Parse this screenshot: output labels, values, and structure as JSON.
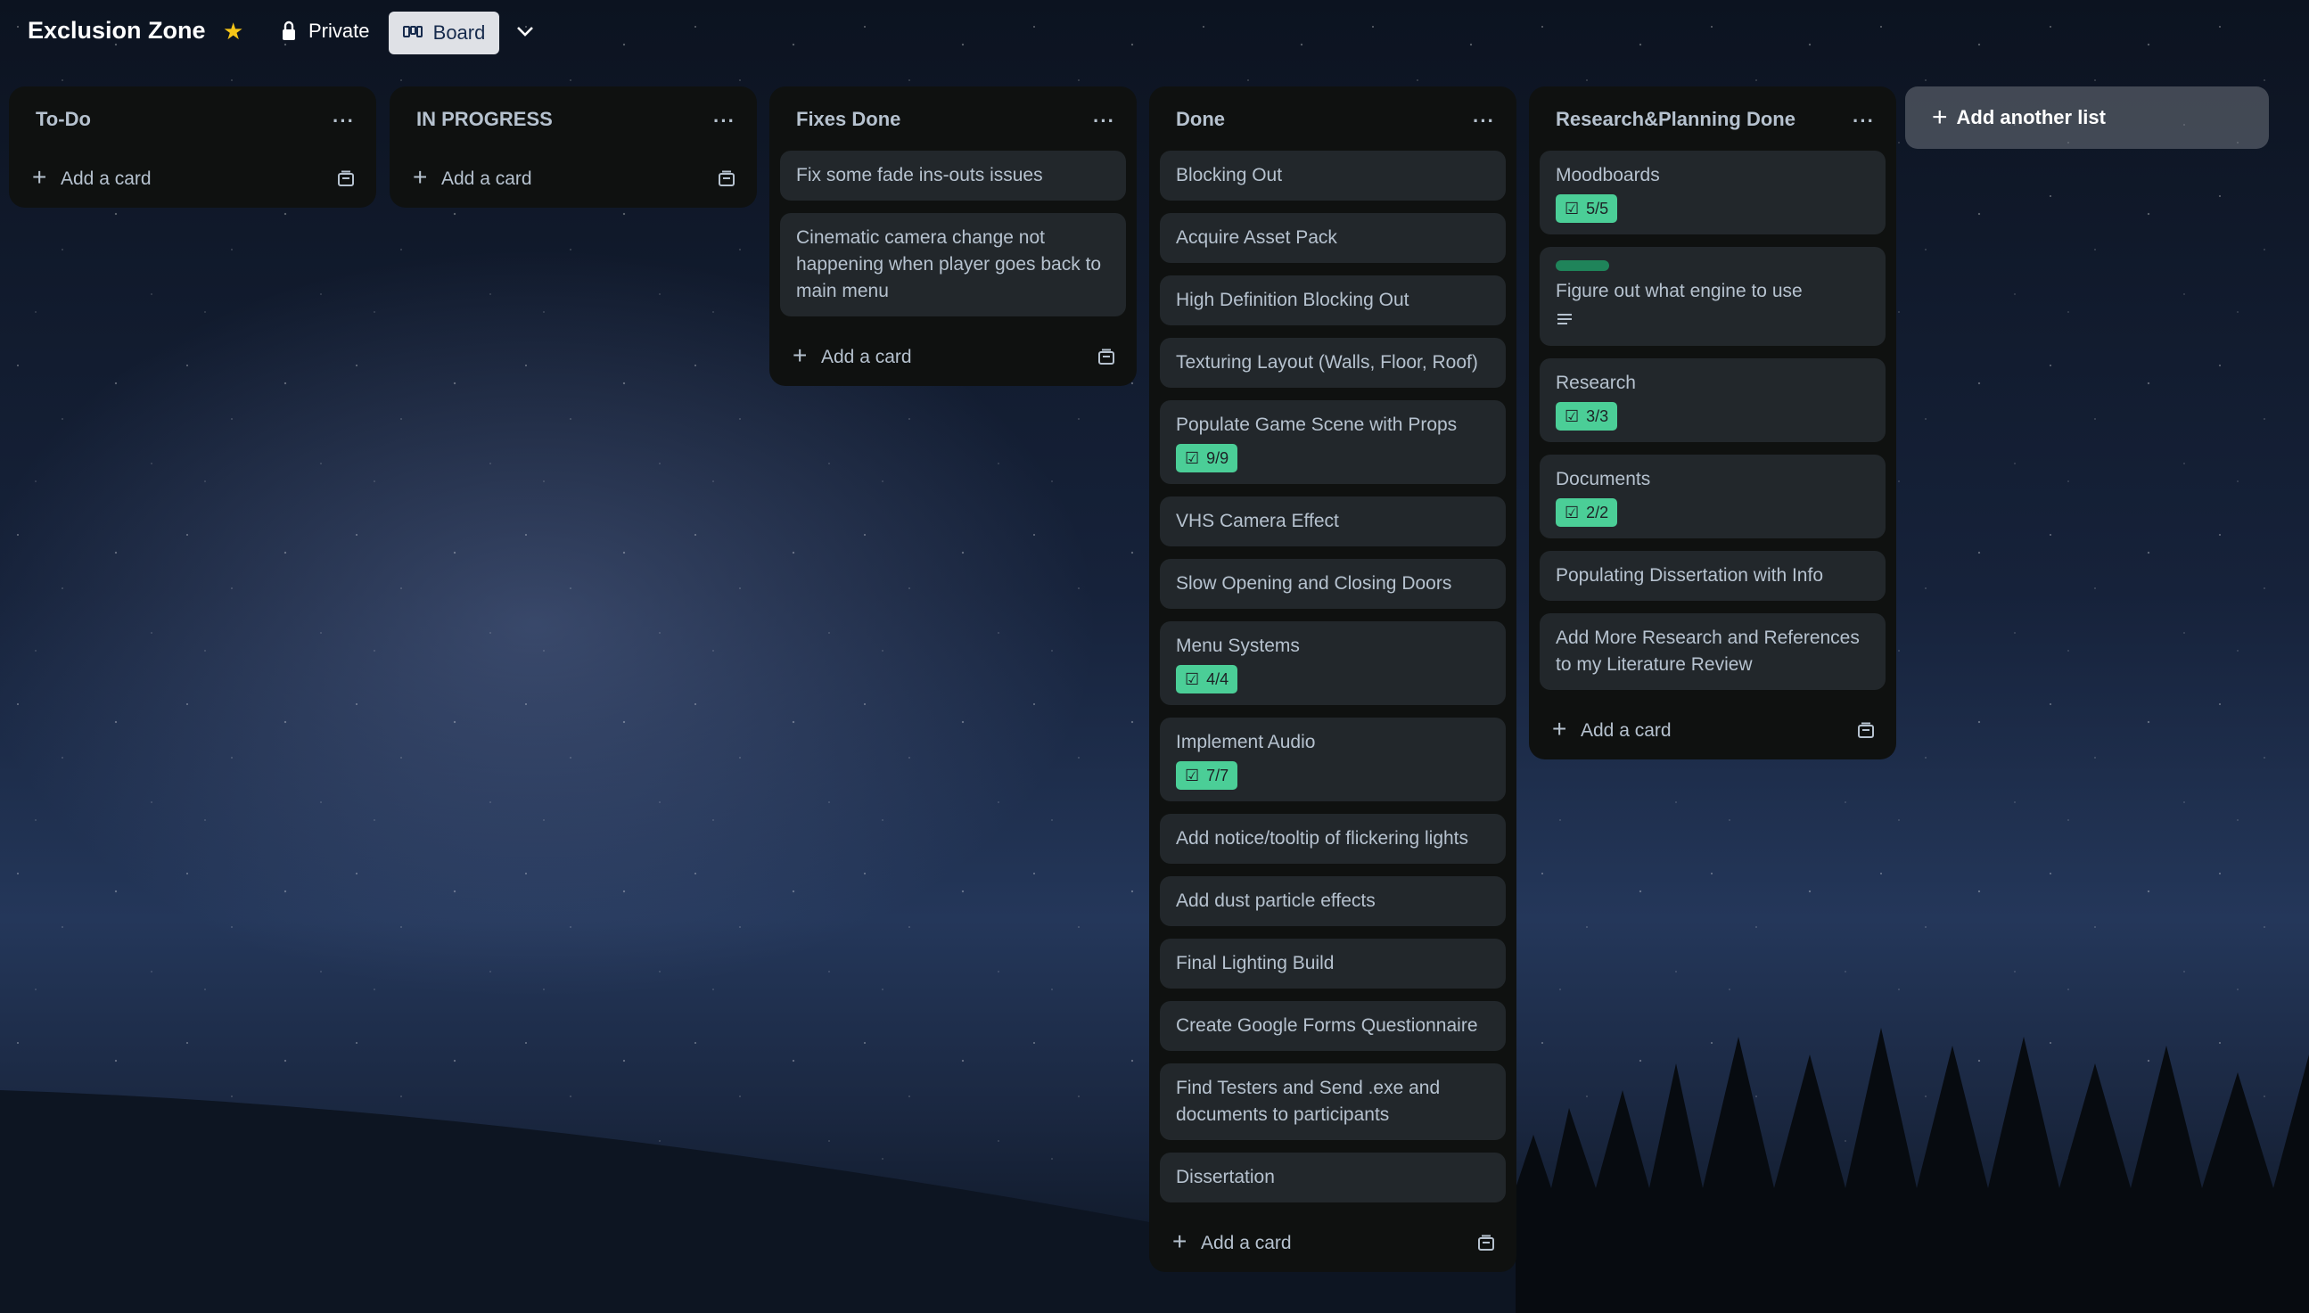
{
  "board": {
    "title": "Exclusion Zone",
    "visibility": "Private",
    "view": "Board",
    "star_icon": "star-icon",
    "colors": {
      "accent": "#f5c518",
      "badge": "#4bce97",
      "list_bg": "#0f1110",
      "card_bg": "#22272b",
      "text": "#b6c2cf"
    }
  },
  "lists": [
    {
      "title": "To-Do",
      "cards": [],
      "add_label": "Add a card"
    },
    {
      "title": "IN PROGRESS",
      "cards": [],
      "add_label": "Add a card"
    },
    {
      "title": "Fixes Done",
      "add_label": "Add a card",
      "cards": [
        {
          "title": "Fix some fade ins-outs issues"
        },
        {
          "title": "Cinematic camera change not happening when player goes back to main menu"
        }
      ]
    },
    {
      "title": "Done",
      "add_label": "Add a card",
      "cards": [
        {
          "title": "Blocking Out"
        },
        {
          "title": "Acquire Asset Pack"
        },
        {
          "title": "High Definition Blocking Out"
        },
        {
          "title": "Texturing Layout (Walls, Floor, Roof)"
        },
        {
          "title": "Populate Game Scene with Props",
          "checklist": "9/9"
        },
        {
          "title": "VHS Camera Effect"
        },
        {
          "title": "Slow Opening and Closing Doors"
        },
        {
          "title": "Menu Systems",
          "checklist": "4/4"
        },
        {
          "title": "Implement Audio",
          "checklist": "7/7"
        },
        {
          "title": "Add notice/tooltip of flickering lights"
        },
        {
          "title": "Add dust particle effects"
        },
        {
          "title": "Final Lighting Build"
        },
        {
          "title": "Create Google Forms Questionnaire"
        },
        {
          "title": "Find Testers and Send .exe and documents to participants"
        },
        {
          "title": "Dissertation"
        }
      ]
    },
    {
      "title": "Research&Planning Done",
      "add_label": "Add a card",
      "cards": [
        {
          "title": "Moodboards",
          "checklist": "5/5"
        },
        {
          "title": "Figure out what engine to use",
          "label": true,
          "description": true
        },
        {
          "title": "Research",
          "checklist": "3/3"
        },
        {
          "title": "Documents",
          "checklist": "2/2"
        },
        {
          "title": "Populating Dissertation with Info"
        },
        {
          "title": "Add More Research and References to my Literature Review"
        }
      ]
    }
  ],
  "add_list_label": "Add another list"
}
